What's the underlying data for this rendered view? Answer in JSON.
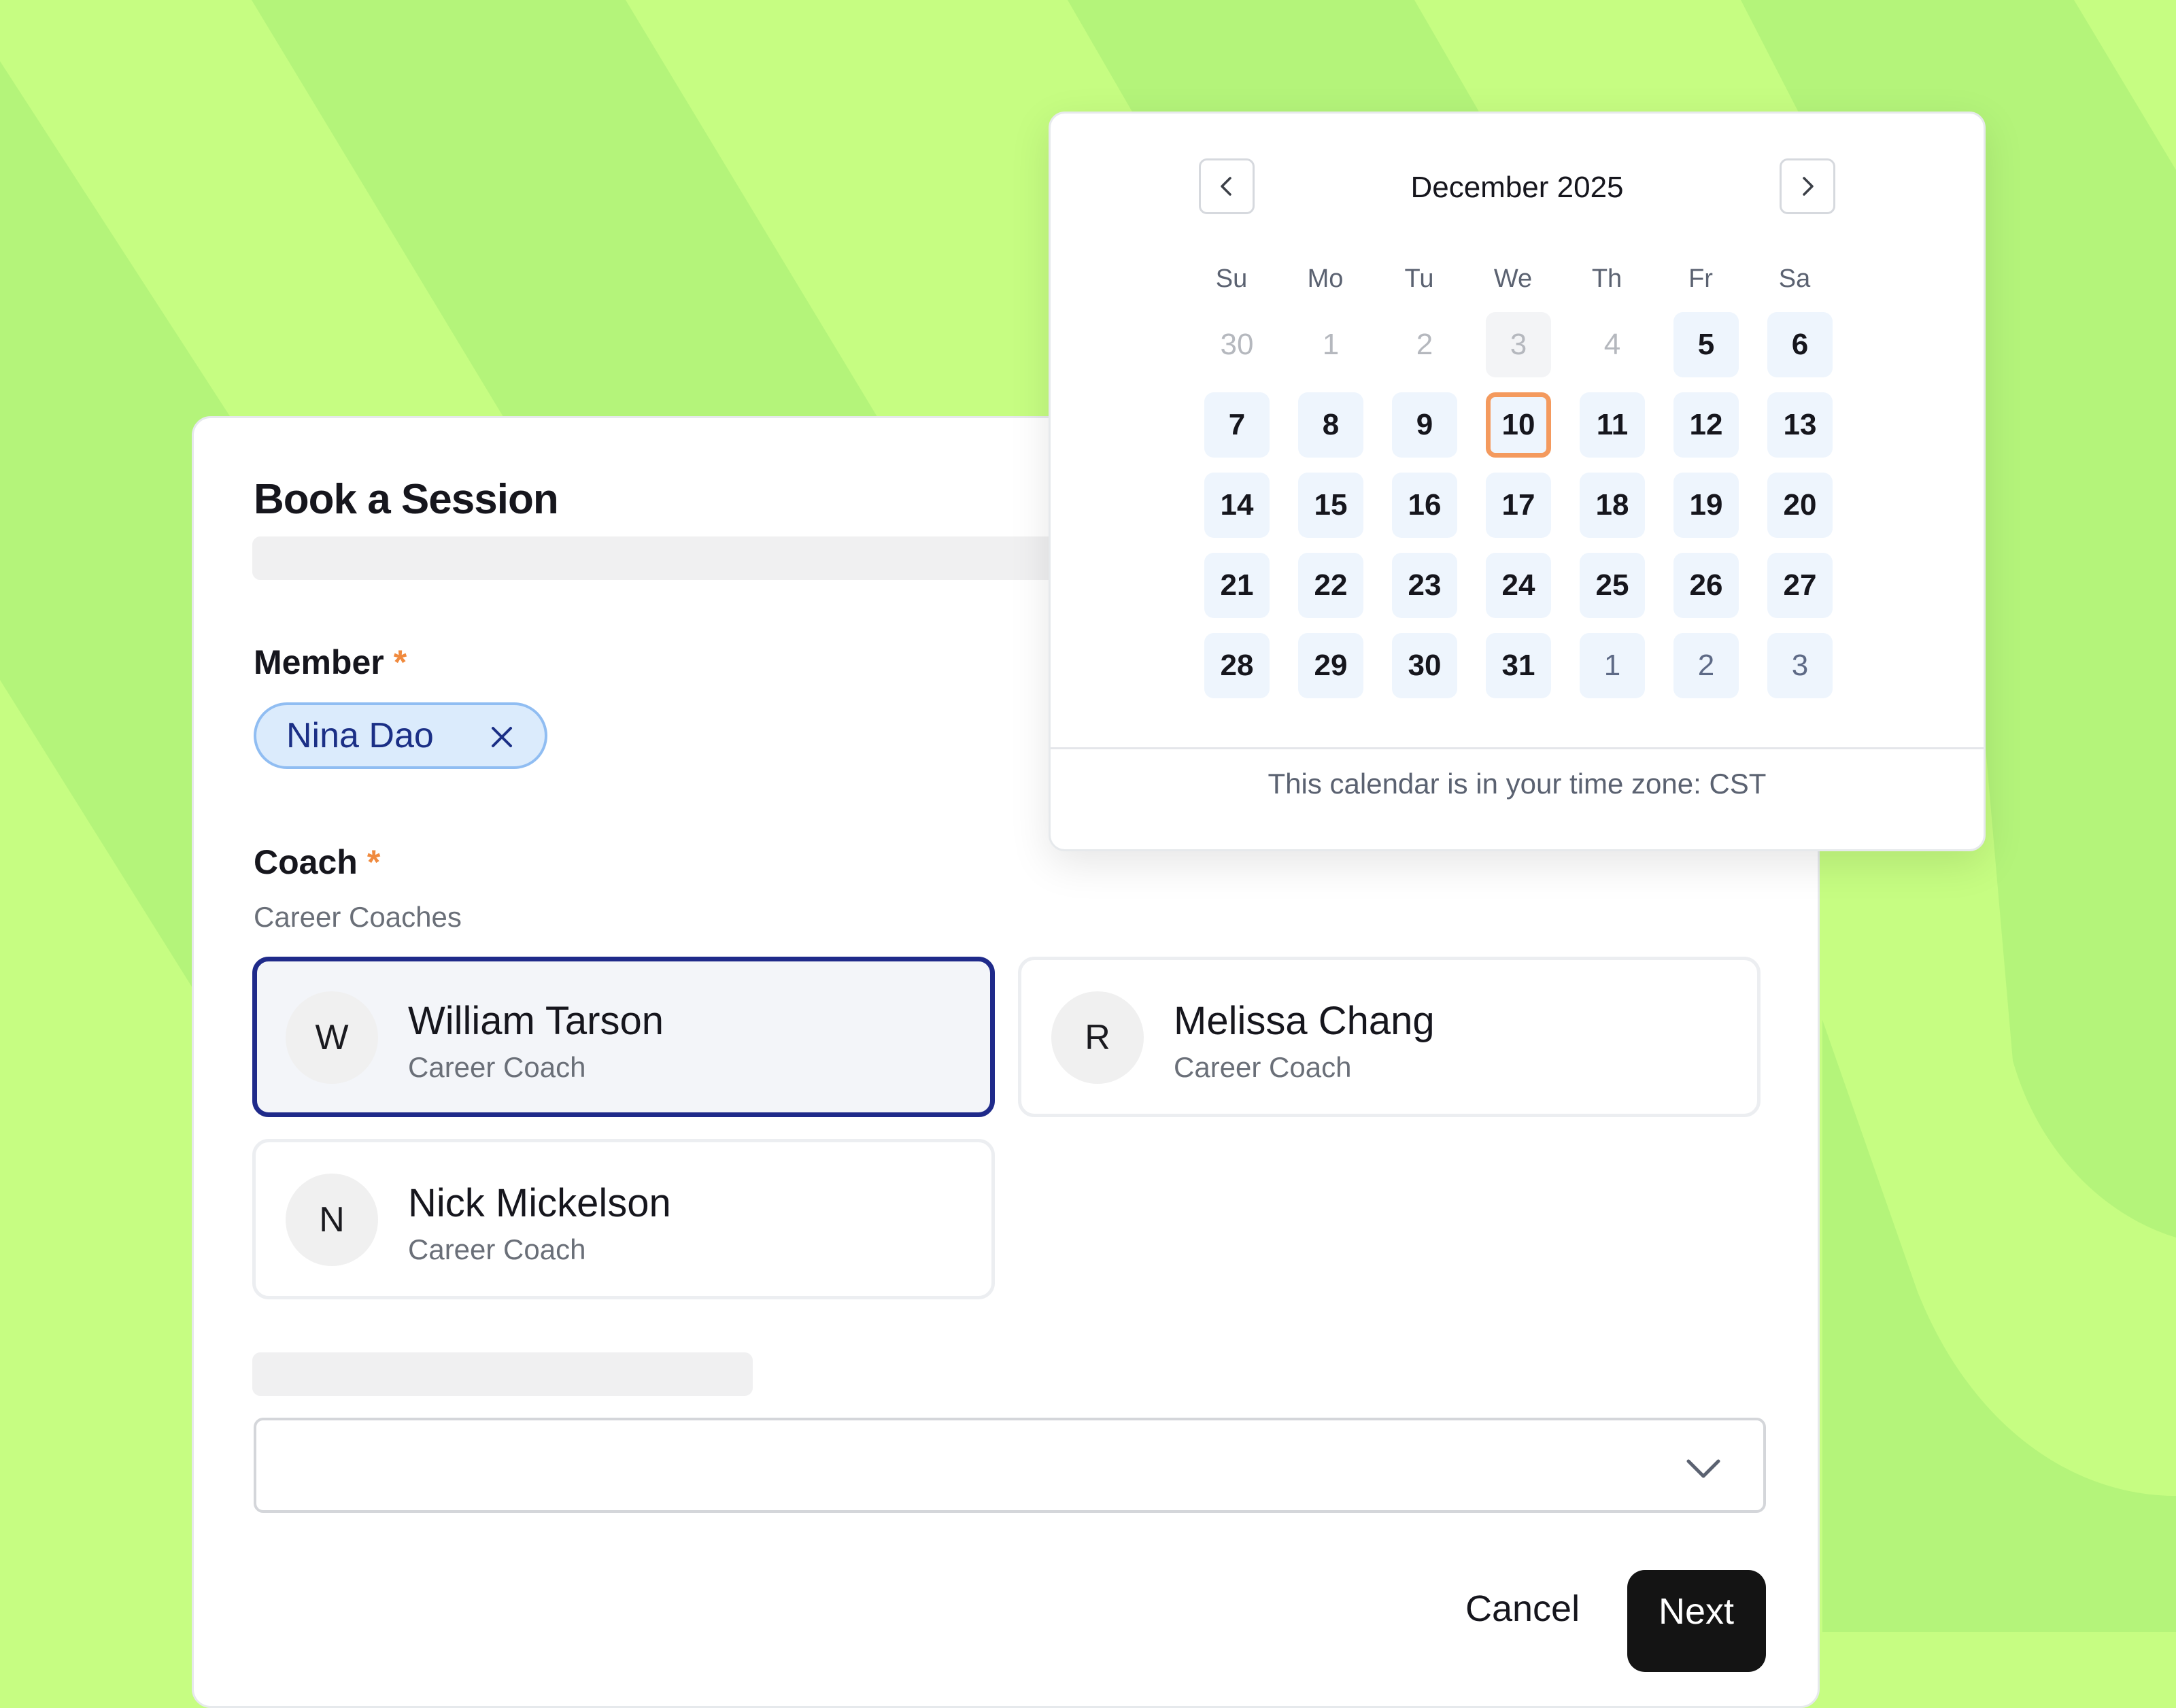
{
  "form": {
    "title": "Book a Session",
    "member_label": "Member",
    "required_mark": "*",
    "member_chip": "Nina Dao",
    "coach_label": "Coach",
    "coach_group": "Career Coaches",
    "coaches": [
      {
        "initial": "W",
        "name": "William Tarson",
        "role": "Career Coach",
        "selected": true
      },
      {
        "initial": "R",
        "name": "Melissa Chang",
        "role": "Career Coach",
        "selected": false
      },
      {
        "initial": "N",
        "name": "Nick Mickelson",
        "role": "Career Coach",
        "selected": false
      }
    ],
    "cancel_label": "Cancel",
    "next_label": "Next"
  },
  "calendar": {
    "month_label": "December 2025",
    "weekdays": [
      "Su",
      "Mo",
      "Tu",
      "We",
      "Th",
      "Fr",
      "Sa"
    ],
    "weeks": [
      [
        "30",
        "1",
        "2",
        "3",
        "4",
        "5",
        "6"
      ],
      [
        "7",
        "8",
        "9",
        "10",
        "11",
        "12",
        "13"
      ],
      [
        "14",
        "15",
        "16",
        "17",
        "18",
        "19",
        "20"
      ],
      [
        "21",
        "22",
        "23",
        "24",
        "25",
        "26",
        "27"
      ],
      [
        "28",
        "29",
        "30",
        "31",
        "1",
        "2",
        "3"
      ]
    ],
    "selected_day": "10",
    "timezone_note": "This calendar is in your time zone: CST"
  },
  "colors": {
    "background": "#c6fd82",
    "stripe": "#b4f47a",
    "selected_border": "#1f2a8a",
    "today_ring": "#f49a5e",
    "chip_bg": "#dbebfc",
    "primary_button": "#141414"
  },
  "icons": {
    "prev": "chevron-left-icon",
    "next": "chevron-right-icon",
    "remove": "close-icon",
    "dropdown": "chevron-down-icon"
  }
}
